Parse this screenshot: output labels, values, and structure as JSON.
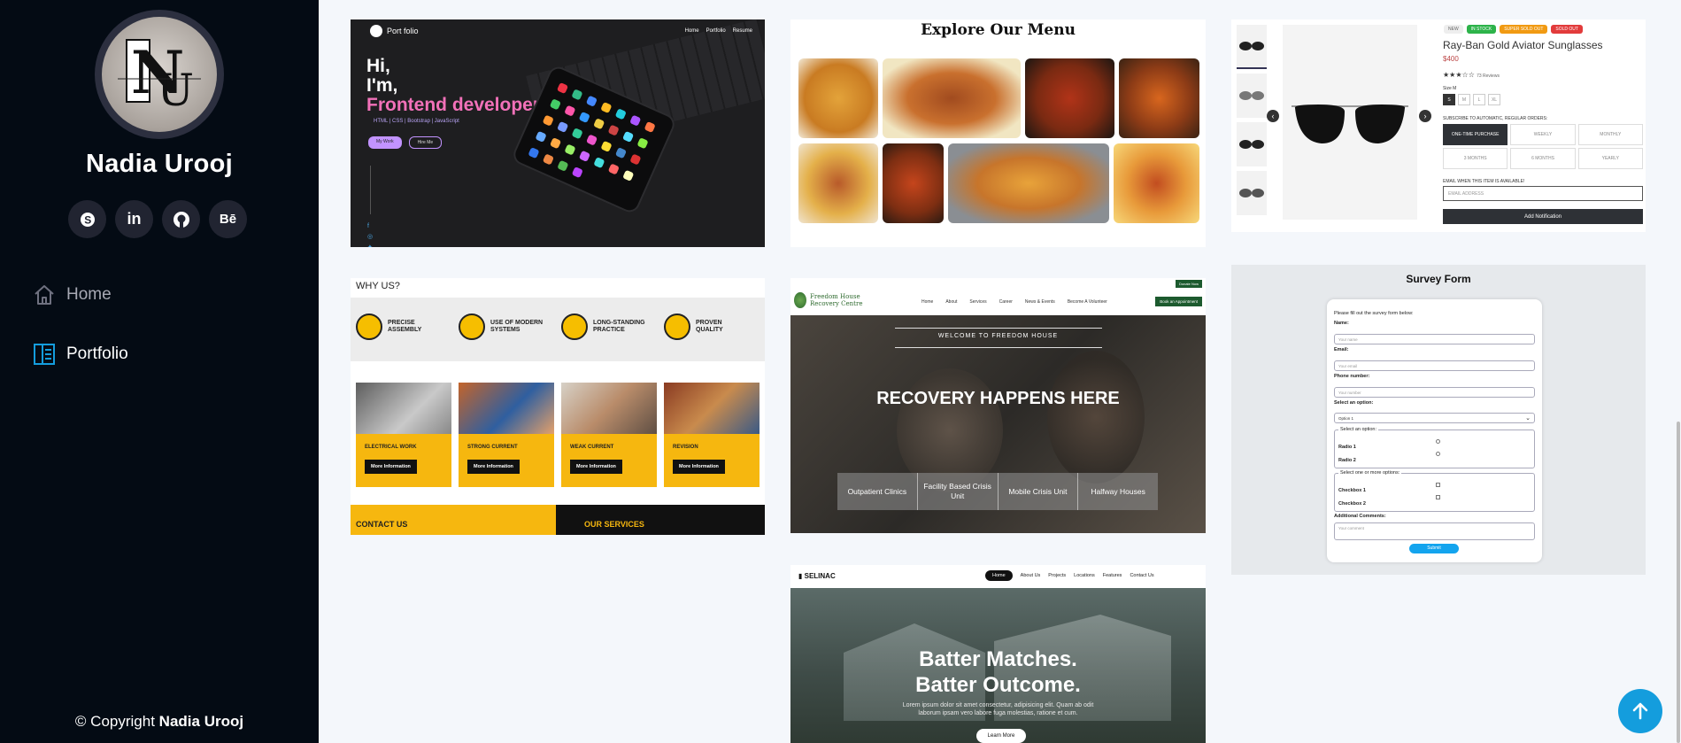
{
  "sidebar": {
    "name": "Nadia Urooj",
    "logo_text": "NU",
    "social": [
      {
        "icon": "skype-icon",
        "glyph": "S"
      },
      {
        "icon": "linkedin-icon",
        "glyph": "in"
      },
      {
        "icon": "github-icon",
        "glyph": "gh"
      },
      {
        "icon": "behance-icon",
        "glyph": "Bē"
      }
    ],
    "nav": [
      {
        "label": "Home",
        "icon": "home-icon",
        "active": false
      },
      {
        "label": "Portfolio",
        "icon": "portfolio-icon",
        "active": true
      }
    ],
    "copyright_prefix": "© Copyright",
    "copyright_name": "Nadia Urooj"
  },
  "colors": {
    "sidebar_bg": "#040b14",
    "accent": "#149ddd",
    "page_bg": "#f4f7fb"
  },
  "portfolio": {
    "c1": {
      "brand": "Port folio",
      "nav": [
        "Home",
        "Portfolio",
        "Resume"
      ],
      "hi": "Hi,",
      "im": "I'm,",
      "role": "Frontend developer",
      "tags": "HTML | CSS | Bootstrap | JavaScript",
      "btn1": "My Work",
      "btn2": "Hire Me"
    },
    "c2": {
      "title": "Explore Our Menu"
    },
    "c3": {
      "badges": [
        "NEW",
        "IN STOCK",
        "SUPER SOLD OUT",
        "SOLD OUT"
      ],
      "name": "Ray-Ban Gold Aviator Sunglasses",
      "price": "$400",
      "reviews": "73 Reviews",
      "size_label": "Size M",
      "sizes": [
        "S",
        "M",
        "L",
        "XL"
      ],
      "subscribe_label": "SUBSCRIBE TO AUTOMATIC, REGULAR ORDERS:",
      "options": [
        "ONE-TIME PURCHASE",
        "WEEKLY",
        "MONTHLY",
        "3 MONTHS",
        "6 MONTHS",
        "YEARLY"
      ],
      "email_label": "EMAIL WHEN THIS ITEM IS AVAILABLE!",
      "email_placeholder": "EMAIL ADDRESS",
      "notify": "Add Notification"
    },
    "c4": {
      "why": "WHY US?",
      "features": [
        "PRECISE ASSEMBLY",
        "USE OF MODERN SYSTEMS",
        "LONG-STANDING PRACTICE",
        "PROVEN QUALITY"
      ],
      "services": [
        "ELECTRICAL WORK",
        "STRONG CURRENT",
        "WEAK CURRENT",
        "REVISION"
      ],
      "more": "More Information",
      "contact": "CONTACT US",
      "our_services": "OUR SERVICES"
    },
    "c5": {
      "brand": "Freedom House Recovery Centre",
      "nav": [
        "Home",
        "About",
        "Services",
        "Career",
        "News & Events",
        "Become A Volunteer"
      ],
      "cta": "Book an Appointment",
      "welcome": "WELCOME TO FREEDOM HOUSE",
      "title": "RECOVERY HAPPENS HERE",
      "boxes": [
        "Outpatient Clinics",
        "Facility Based Crisis Unit",
        "Mobile Crisis Unit",
        "Halfway Houses"
      ]
    },
    "c6": {
      "title": "Survey Form",
      "intro": "Please fill out the survey form below:",
      "name_label": "Name:",
      "name_ph": "Your name",
      "email_label": "Email:",
      "email_ph": "Your email",
      "phone_label": "Phone number:",
      "phone_ph": "Your number",
      "select_label": "Select an option:",
      "select_value": "Option 1",
      "radio_legend": "Select an option:",
      "radio1": "Radio 1",
      "radio2": "Radio 2",
      "check_legend": "Select one or more options:",
      "check1": "Checkbox 1",
      "check2": "Checkbox 2",
      "comments_label": "Additional Comments:",
      "comments_ph": "Your comment",
      "submit": "Submit"
    },
    "c7": {
      "brand": "SELINAC",
      "nav": [
        "Home",
        "About Us",
        "Projects",
        "Locations",
        "Features",
        "Contact Us"
      ],
      "h1a": "Batter Matches.",
      "h1b": "Batter Outcome.",
      "p": "Lorem ipsum dolor sit amet consectetur, adipisicing elit. Quam ab odit laborum ipsam vero labore fuga molestias, ratione et cum.",
      "btn": "Learn More"
    }
  }
}
